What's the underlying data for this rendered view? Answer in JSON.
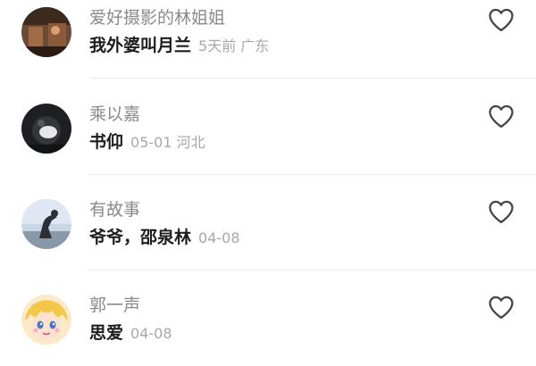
{
  "comments": [
    {
      "username": "爱好摄影的林姐姐",
      "text": "我外婆叫月兰",
      "meta": "5天前 广东",
      "avatar_icon": "avatar-photo-warm-interior-icon",
      "like_icon": "heart-outline-icon"
    },
    {
      "username": "乘以嘉",
      "text": "书仰",
      "meta": "05-01 河北",
      "avatar_icon": "avatar-photo-dark-icon",
      "like_icon": "heart-outline-icon"
    },
    {
      "username": "有故事",
      "text": "爷爷，邵泉林",
      "meta": "04-08",
      "avatar_icon": "avatar-photo-silhouette-icon",
      "like_icon": "heart-outline-icon"
    },
    {
      "username": "郭一声",
      "text": "思爱",
      "meta": "04-08",
      "avatar_icon": "avatar-cartoon-character-icon",
      "like_icon": "heart-outline-icon"
    }
  ],
  "colors": {
    "username": "#8a8a8a",
    "text": "#1c1c1c",
    "meta": "#a8a8a8",
    "divider": "#ededed",
    "heart_stroke": "#444444"
  }
}
